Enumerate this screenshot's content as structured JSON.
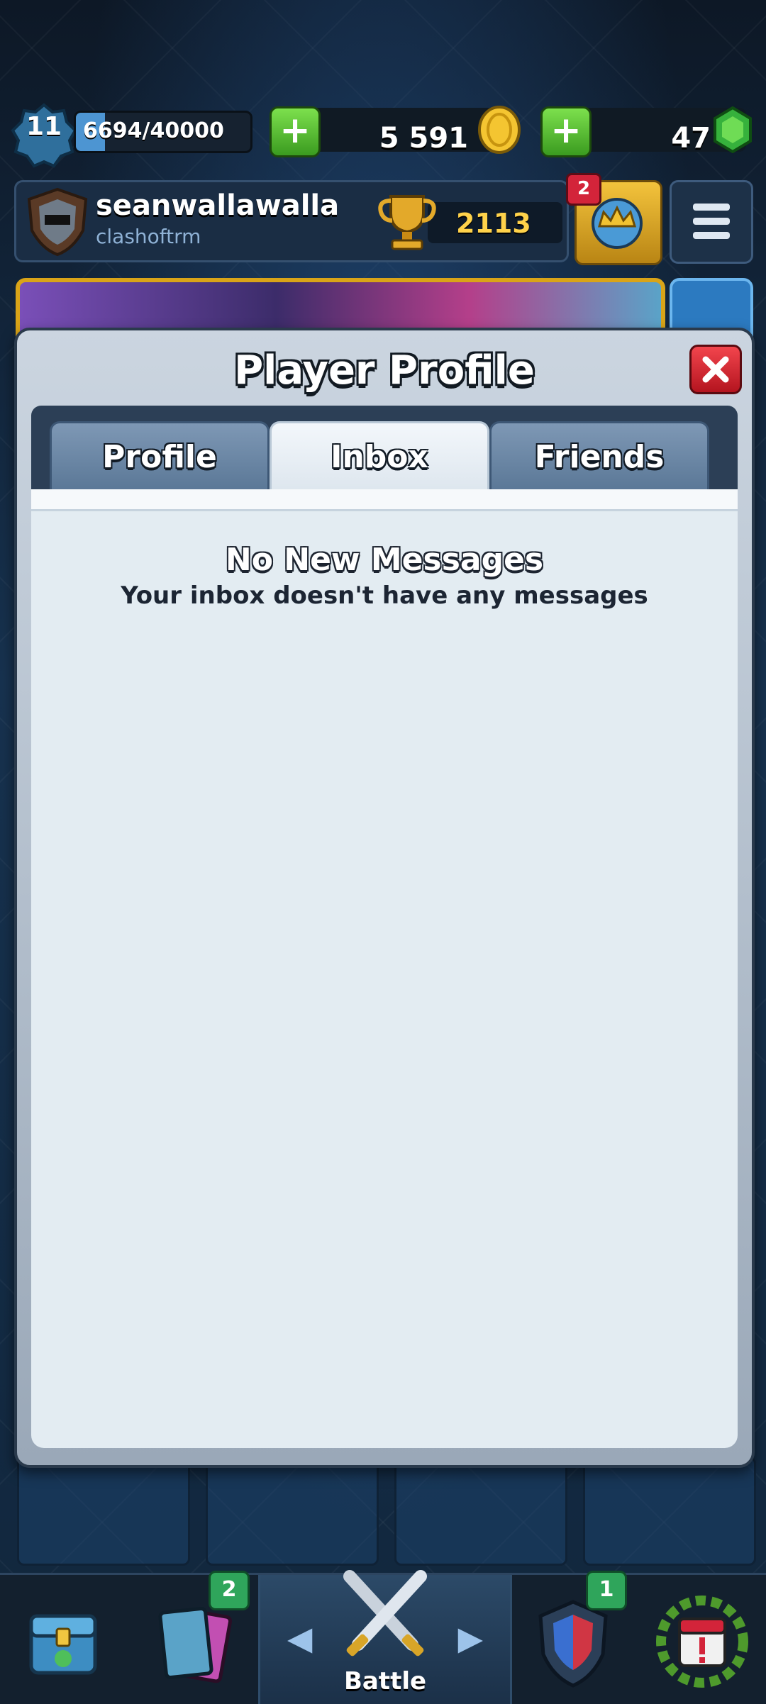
{
  "status": {
    "level": "11",
    "xp": "6694/40000",
    "xp_progress": 0.167,
    "gold": "5 591",
    "gems": "47"
  },
  "player": {
    "name": "seanwallawalla",
    "clan": "clashoftrm",
    "trophies": "2113",
    "notification_count": "2"
  },
  "modal": {
    "title": "Player Profile",
    "tabs": [
      "Profile",
      "Inbox",
      "Friends"
    ],
    "active_tab": "Inbox",
    "message_title": "No New Messages",
    "message_subtitle": "Your inbox doesn't have any messages"
  },
  "nav": {
    "cards_badge": "2",
    "social_badge": "1",
    "battle_label": "Battle"
  },
  "icons": {
    "level": "level-badge-icon",
    "gold": "gold-coin-icon",
    "gems": "gem-icon",
    "trophy": "trophy-icon",
    "close": "close-icon",
    "menu": "hamburger-menu-icon"
  },
  "colors": {
    "accent_green": "#3b9b20",
    "close_red": "#d3243a",
    "gold": "#ffd24a",
    "xp_blue": "#4d95d2"
  }
}
